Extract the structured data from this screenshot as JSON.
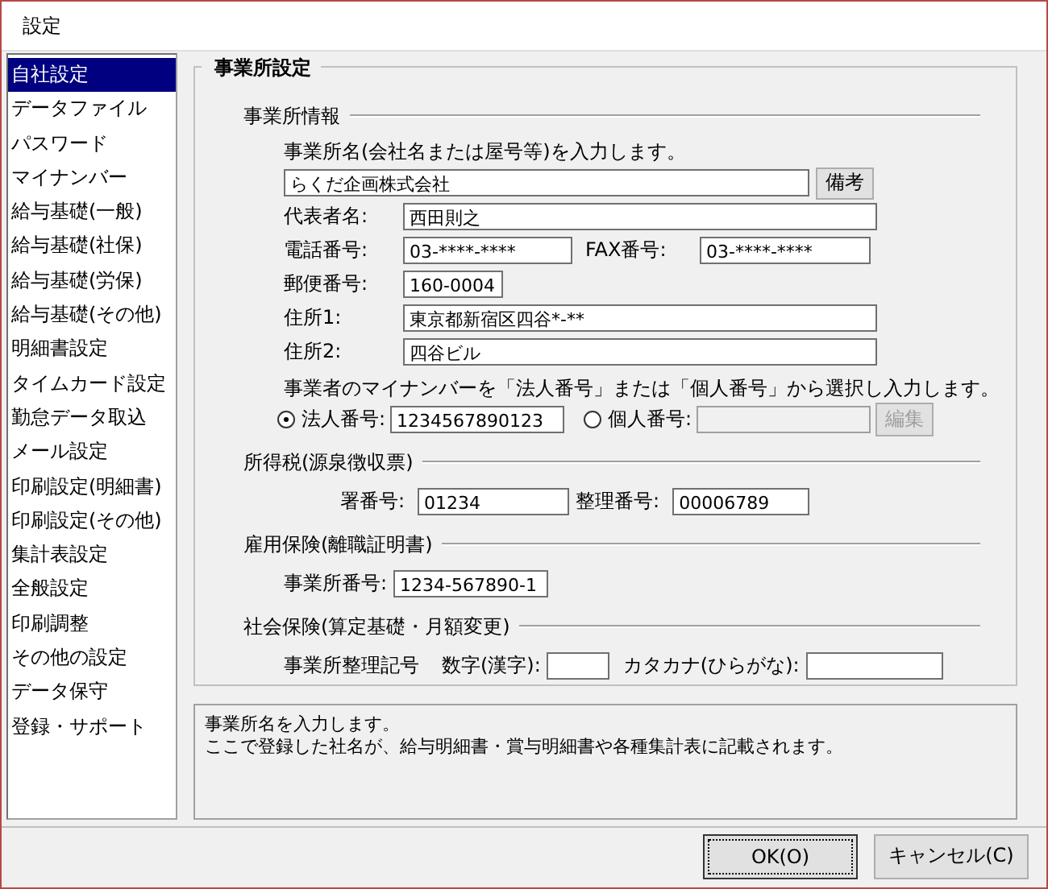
{
  "window": {
    "title": "設定"
  },
  "sidebar": {
    "items": [
      {
        "label": "自社設定",
        "selected": true
      },
      {
        "label": "データファイル",
        "selected": false
      },
      {
        "label": "パスワード",
        "selected": false
      },
      {
        "label": "マイナンバー",
        "selected": false
      },
      {
        "label": "給与基礎(一般)",
        "selected": false
      },
      {
        "label": "給与基礎(社保)",
        "selected": false
      },
      {
        "label": "給与基礎(労保)",
        "selected": false
      },
      {
        "label": "給与基礎(その他)",
        "selected": false
      },
      {
        "label": "明細書設定",
        "selected": false
      },
      {
        "label": "タイムカード設定",
        "selected": false
      },
      {
        "label": "勤怠データ取込",
        "selected": false
      },
      {
        "label": "メール設定",
        "selected": false
      },
      {
        "label": "印刷設定(明細書)",
        "selected": false
      },
      {
        "label": "印刷設定(その他)",
        "selected": false
      },
      {
        "label": "集計表設定",
        "selected": false
      },
      {
        "label": "全般設定",
        "selected": false
      },
      {
        "label": "印刷調整",
        "selected": false
      },
      {
        "label": "その他の設定",
        "selected": false
      },
      {
        "label": "データ保守",
        "selected": false
      },
      {
        "label": "登録・サポート",
        "selected": false
      }
    ]
  },
  "group": {
    "title": "事業所設定",
    "office_info": {
      "title": "事業所情報",
      "name_prompt": "事業所名(会社名または屋号等)を入力します。",
      "company_name": "らくだ企画株式会社",
      "memo_button": "備考",
      "representative": {
        "label": "代表者名:",
        "value": "西田則之"
      },
      "phone": {
        "label": "電話番号:",
        "value": "03-****-****"
      },
      "fax": {
        "label": "FAX番号:",
        "value": "03-****-****"
      },
      "postal": {
        "label": "郵便番号:",
        "value": "160-0004"
      },
      "address1": {
        "label": "住所1:",
        "value": "東京都新宿区四谷*-**"
      },
      "address2": {
        "label": "住所2:",
        "value": "四谷ビル"
      },
      "mynumber_prompt": "事業者のマイナンバーを「法人番号」または「個人番号」から選択し入力します。",
      "radios": [
        {
          "label": "法人番号:",
          "value": "1234567890123",
          "selected": true,
          "disabled": false
        },
        {
          "label": "個人番号:",
          "selected": false,
          "disabled": true
        }
      ],
      "edit_button": {
        "label": "編集",
        "disabled": true
      }
    },
    "income_tax": {
      "title": "所得税(源泉徴収票)",
      "fields": [
        {
          "label": "署番号:",
          "value": "01234"
        },
        {
          "label": "整理番号:",
          "value": "00006789"
        }
      ]
    },
    "employment": {
      "title": "雇用保険(離職証明書)",
      "fields": [
        {
          "label": "事業所番号:",
          "value": "1234-567890-1"
        }
      ]
    },
    "social": {
      "title": "社会保険(算定基礎・月額変更)",
      "label": "事業所整理記号",
      "fields": [
        {
          "label": "数字(漢字):"
        },
        {
          "label": "カタカナ(ひらがな):"
        }
      ]
    }
  },
  "help": {
    "lines": [
      "事業所名を入力します。",
      "ここで登録した社名が、給与明細書・賞与明細書や各種集計表に記載されます。"
    ]
  },
  "buttons": [
    {
      "label": "OK(O)",
      "focused": true
    },
    {
      "label": "キャンセル(C)",
      "focused": false
    }
  ]
}
